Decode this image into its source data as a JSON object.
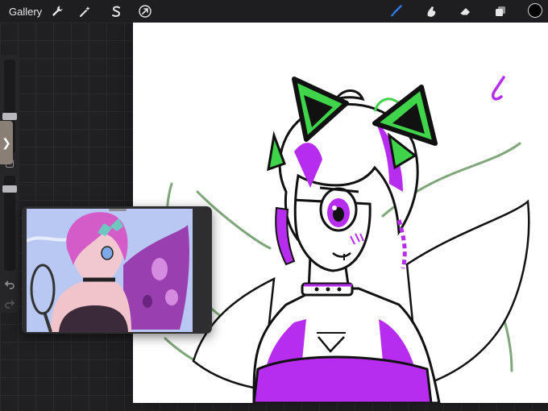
{
  "toolbar": {
    "gallery_label": "Gallery",
    "left_tools": [
      "wrench-icon",
      "magic-wand-icon",
      "selection-s-icon",
      "transform-arrow-icon"
    ],
    "right_tools": [
      "brush-icon",
      "smudge-icon",
      "eraser-icon",
      "layers-icon"
    ],
    "active_tool": "brush-icon",
    "active_color": "#000000",
    "accent_color": "#2f7bf5"
  },
  "sidebar": {
    "size_slider_level": 0.3,
    "opacity_slider_level": 0.9,
    "undo_icon": "undo-arrow-icon",
    "redo_icon": "redo-arrow-icon",
    "tab_glyph": "❯"
  },
  "colors": {
    "lineart": "#0a0a0a",
    "magenta": "#b72df0",
    "green_ears": "#3fd449",
    "wing_sketch": "#7fa77a"
  }
}
